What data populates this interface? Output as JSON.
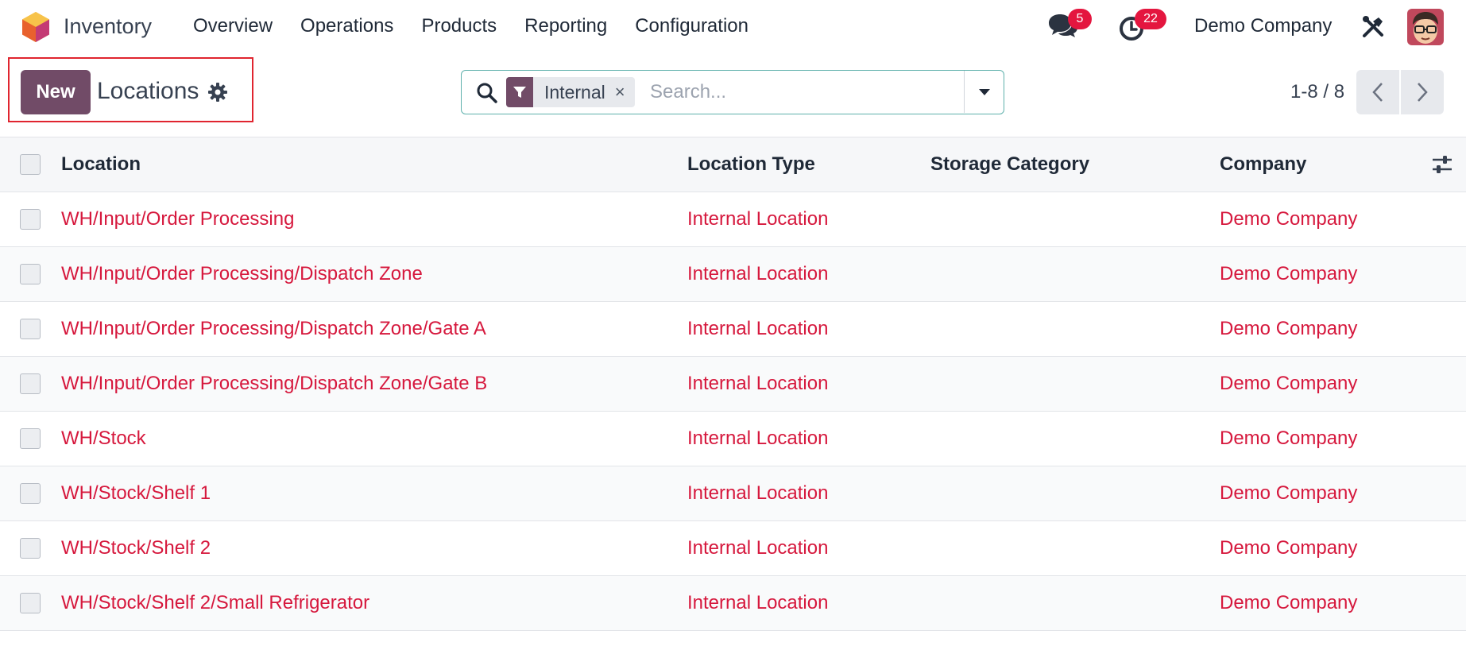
{
  "app": {
    "name": "Inventory",
    "menu": [
      "Overview",
      "Operations",
      "Products",
      "Reporting",
      "Configuration"
    ]
  },
  "systray": {
    "messages_count": "5",
    "activities_count": "22",
    "company": "Demo Company"
  },
  "control_panel": {
    "new_label": "New",
    "title": "Locations",
    "search": {
      "facet_label": "Internal",
      "remove_glyph": "×",
      "placeholder": "Search..."
    },
    "pager": "1-8 / 8"
  },
  "table": {
    "columns": [
      "Location",
      "Location Type",
      "Storage Category",
      "Company"
    ],
    "rows": [
      {
        "location": "WH/Input/Order Processing",
        "type": "Internal Location",
        "storage": "",
        "company": "Demo Company"
      },
      {
        "location": "WH/Input/Order Processing/Dispatch Zone",
        "type": "Internal Location",
        "storage": "",
        "company": "Demo Company"
      },
      {
        "location": "WH/Input/Order Processing/Dispatch Zone/Gate A",
        "type": "Internal Location",
        "storage": "",
        "company": "Demo Company"
      },
      {
        "location": "WH/Input/Order Processing/Dispatch Zone/Gate B",
        "type": "Internal Location",
        "storage": "",
        "company": "Demo Company"
      },
      {
        "location": "WH/Stock",
        "type": "Internal Location",
        "storage": "",
        "company": "Demo Company"
      },
      {
        "location": "WH/Stock/Shelf 1",
        "type": "Internal Location",
        "storage": "",
        "company": "Demo Company"
      },
      {
        "location": "WH/Stock/Shelf 2",
        "type": "Internal Location",
        "storage": "",
        "company": "Demo Company"
      },
      {
        "location": "WH/Stock/Shelf 2/Small Refrigerator",
        "type": "Internal Location",
        "storage": "",
        "company": "Demo Company"
      }
    ]
  },
  "colors": {
    "brand": "#714b67",
    "link": "#d6183d",
    "badge": "#e4163f",
    "highlight": "#e0252f"
  },
  "icons": [
    "app-logo-icon",
    "chat-icon",
    "clock-icon",
    "tools-icon",
    "gear-icon",
    "search-icon",
    "filter-icon",
    "caret-down-icon",
    "chevron-left-icon",
    "chevron-right-icon",
    "optional-columns-icon"
  ]
}
